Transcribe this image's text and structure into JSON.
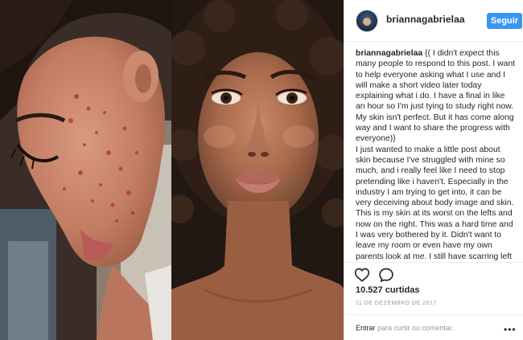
{
  "header": {
    "username": "briannagabrielaa",
    "follow_label": "Seguir"
  },
  "caption": {
    "username": "briannagabrielaa",
    "text": "{( I didn't expect this many people to respond to this post. I want to help everyone asking what I use and I will make a short video later today explaining what i do. I have a final in like an hour so I'm just tying to study right now. My skin isn't perfect. But it has come along way and I want to share the progress with everyone)}\nI just wanted to make a little post about skin because I've struggled with mine so much, and i really feel like I need to stop pretending like i haven't. Especially in the industry I am trying to get into, it can be very deceiving about body image and skin. This is my skin at its worst on the lefts and now on the right. This was a hard time and I was very bothered by it. Didn't want to leave my room or even have my own parents look at me. I still have scarring left which I am working with a doctor to fix"
  },
  "actions": {
    "like_icon": "heart-icon",
    "comment_icon": "comment-icon"
  },
  "likes": "10.527 curtidas",
  "date": "11 DE DEZEMBRO DE 2017",
  "comment_box": {
    "login_label": "Entrar",
    "prompt_rest": " para curtir ou comentar.",
    "more_icon": "more-options-icon"
  }
}
